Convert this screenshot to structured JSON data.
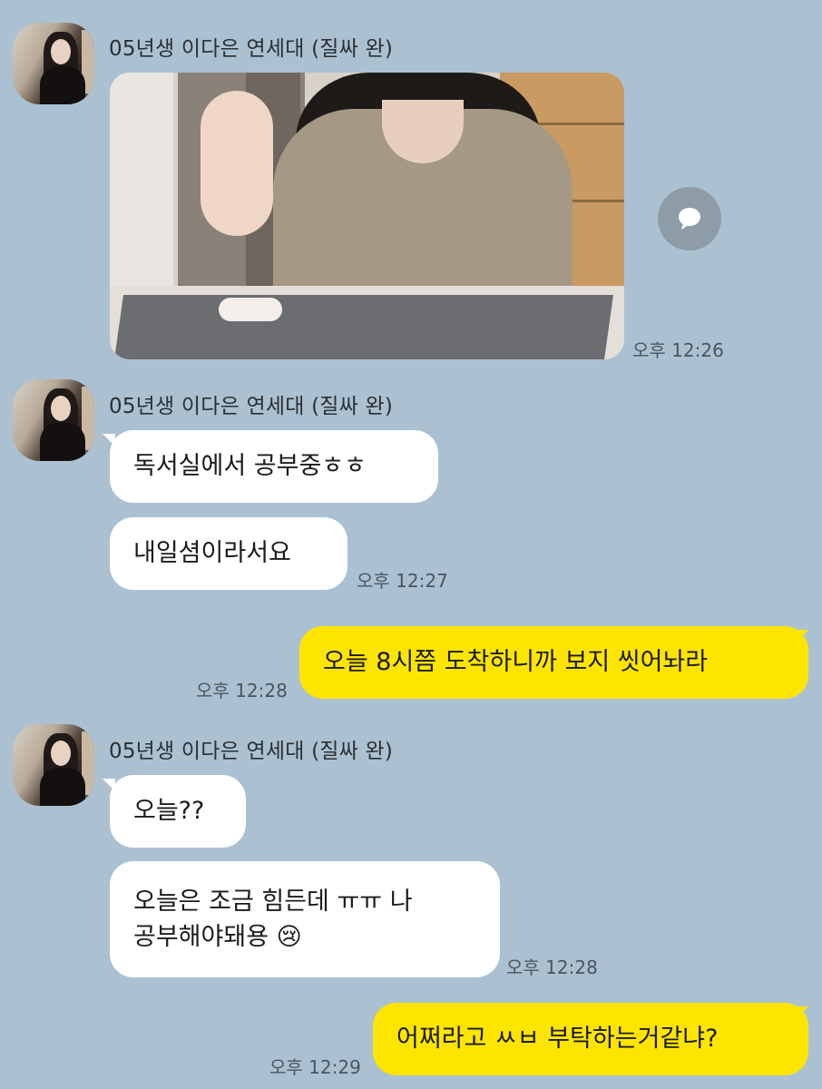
{
  "sender": {
    "name": "05년생 이다은 연세대 (질싸 완)"
  },
  "messages": [
    {
      "type": "photo",
      "direction": "in",
      "time": "오후 12:26"
    },
    {
      "type": "text",
      "direction": "in",
      "text": "독서실에서 공부중ㅎㅎ"
    },
    {
      "type": "text",
      "direction": "in",
      "text": "내일셤이라서요",
      "time": "오후 12:27"
    },
    {
      "type": "text",
      "direction": "out",
      "text": "오늘 8시쯤 도착하니까 보지 씻어놔라",
      "time": "오후 12:28"
    },
    {
      "type": "text",
      "direction": "in",
      "text": "오늘??"
    },
    {
      "type": "text",
      "direction": "in",
      "text": "오늘은 조금 힘든데 ㅠㅠ 나\n공부해야돼용 😢",
      "time": "오후 12:28"
    },
    {
      "type": "text",
      "direction": "out",
      "text": "어쩌라고 ㅆㅂ 부탁하는거같냐?",
      "time": "오후 12:29"
    }
  ],
  "icons": {
    "share": "chat-bubble-share-icon",
    "avatar": "profile-avatar"
  },
  "colors": {
    "background": "#abc1d1",
    "incoming_bubble": "#ffffff",
    "outgoing_bubble": "#fee500",
    "timestamp": "#4a5560"
  }
}
